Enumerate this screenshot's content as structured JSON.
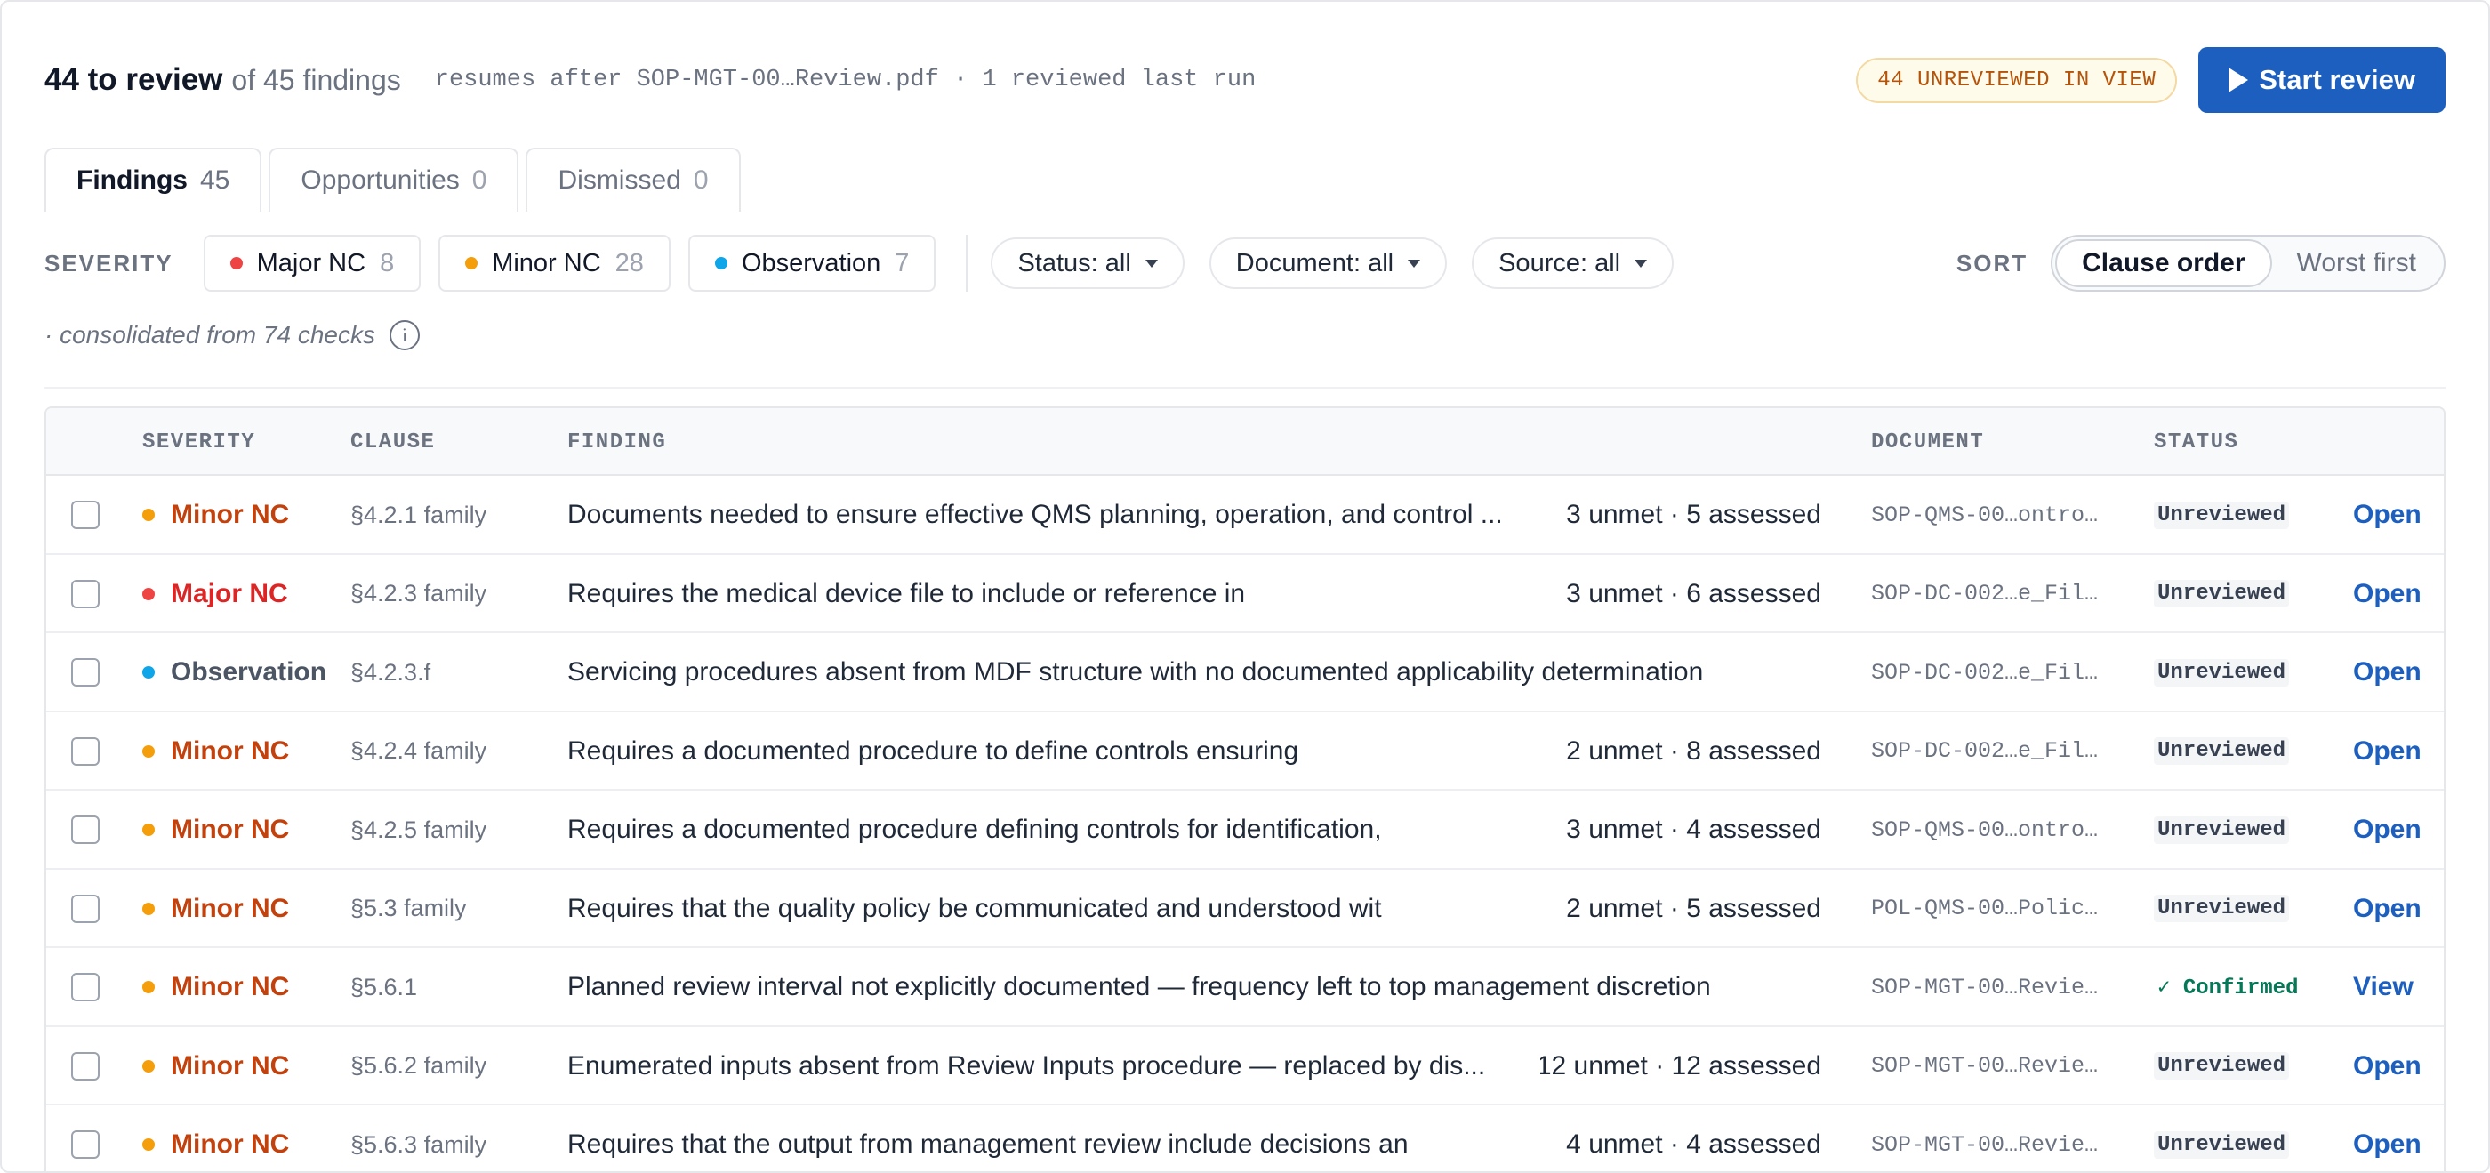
{
  "header": {
    "count_strong": "44 to review",
    "count_rest": "of 45 findings",
    "resume_note": "resumes after SOP-MGT-00…Review.pdf · 1 reviewed last run",
    "unreviewed_pill": "44 UNREVIEWED IN VIEW",
    "start_label": "Start review"
  },
  "tabs": [
    {
      "label": "Findings",
      "count": "45"
    },
    {
      "label": "Opportunities",
      "count": "0"
    },
    {
      "label": "Dismissed",
      "count": "0"
    }
  ],
  "filters": {
    "severity_label": "SEVERITY",
    "chips": [
      {
        "label": "Major NC",
        "count": "8"
      },
      {
        "label": "Minor NC",
        "count": "28"
      },
      {
        "label": "Observation",
        "count": "7"
      }
    ],
    "status_dropdown": "Status: all",
    "document_dropdown": "Document: all",
    "source_dropdown": "Source: all",
    "sort_label": "SORT",
    "sort_options": [
      "Clause order",
      "Worst first"
    ]
  },
  "consolidated_note": "· consolidated from 74 checks",
  "table": {
    "headers": {
      "severity": "SEVERITY",
      "clause": "CLAUSE",
      "finding": "FINDING",
      "document": "DOCUMENT",
      "status": "STATUS"
    },
    "rows": [
      {
        "severity": "Minor NC",
        "clause": "§4.2.1 family",
        "finding": "Documents needed to ensure effective QMS planning, operation, and control ...",
        "assessed": "3 unmet · 5 assessed",
        "document": "SOP-QMS-00…ontro…",
        "status": "Unreviewed",
        "action": "Open"
      },
      {
        "severity": "Major NC",
        "clause": "§4.2.3 family",
        "finding": "Requires the medical device file to include or reference in",
        "assessed": "3 unmet · 6 assessed",
        "document": "SOP-DC-002…e_Fil…",
        "status": "Unreviewed",
        "action": "Open"
      },
      {
        "severity": "Observation",
        "clause": "§4.2.3.f",
        "finding": "Servicing procedures absent from MDF structure with no documented applicability determination",
        "assessed": "",
        "document": "SOP-DC-002…e_Fil…",
        "status": "Unreviewed",
        "action": "Open"
      },
      {
        "severity": "Minor NC",
        "clause": "§4.2.4 family",
        "finding": "Requires a documented procedure to define controls ensuring",
        "assessed": "2 unmet · 8 assessed",
        "document": "SOP-DC-002…e_Fil…",
        "status": "Unreviewed",
        "action": "Open"
      },
      {
        "severity": "Minor NC",
        "clause": "§4.2.5 family",
        "finding": "Requires a documented procedure defining controls for identification,",
        "assessed": "3 unmet · 4 assessed",
        "document": "SOP-QMS-00…ontro…",
        "status": "Unreviewed",
        "action": "Open"
      },
      {
        "severity": "Minor NC",
        "clause": "§5.3 family",
        "finding": "Requires that the quality policy be communicated and understood wit",
        "assessed": "2 unmet · 5 assessed",
        "document": "POL-QMS-00…Polic…",
        "status": "Unreviewed",
        "action": "Open"
      },
      {
        "severity": "Minor NC",
        "clause": "§5.6.1",
        "finding": "Planned review interval not explicitly documented — frequency left to top management discretion",
        "assessed": "",
        "document": "SOP-MGT-00…Revie…",
        "status": "✓ Confirmed",
        "action": "View"
      },
      {
        "severity": "Minor NC",
        "clause": "§5.6.2 family",
        "finding": "Enumerated inputs absent from Review Inputs procedure — replaced by dis...",
        "assessed": "12 unmet · 12 assessed",
        "document": "SOP-MGT-00…Revie…",
        "status": "Unreviewed",
        "action": "Open"
      },
      {
        "severity": "Minor NC",
        "clause": "§5.6.3 family",
        "finding": "Requires that the output from management review include decisions an",
        "assessed": "4 unmet · 4 assessed",
        "document": "SOP-MGT-00…Revie…",
        "status": "Unreviewed",
        "action": "Open"
      }
    ]
  },
  "colors": {
    "major": "#dc2626",
    "minor": "#c2410c",
    "minor_dot": "#f59e0b",
    "observation": "#4b5563",
    "observation_dot": "#0ea5e9",
    "accent": "#1d5fbf",
    "confirmed": "#047857"
  }
}
